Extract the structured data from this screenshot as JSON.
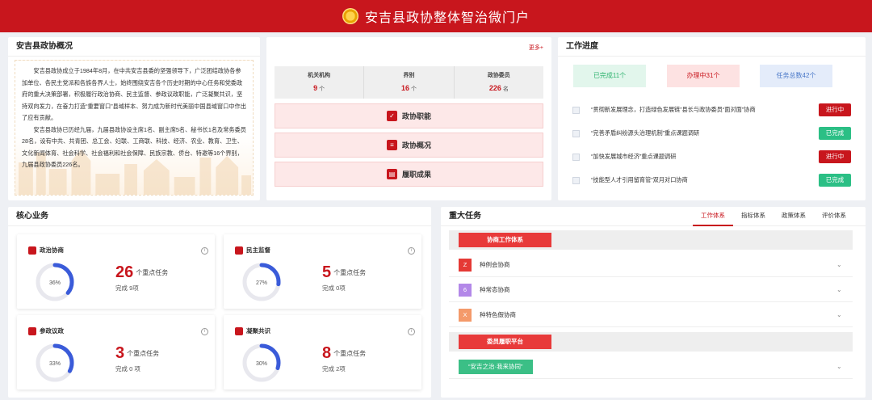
{
  "header": {
    "title": "安吉县政协整体智治微门户"
  },
  "intro": {
    "title": "安吉县政协概况",
    "paragraphs": [
      "安吉县政协成立于1984年8月，在中共安吉县委的坚强领导下，广泛团结政协各参加单位、各民主党派和各族各界人士，始终围绕安吉各个历史时期的中心任务和党委政府的重大决策部署，积极履行政治协商、民主监督、参政议政职能，广泛凝聚共识，坚持双向发力，在奋力打造“重要窗口”县域样本、努力成为新时代美丽中国县域窗口中作出了应有贡献。",
      "安吉县政协已历经九届，九届县政协设主席1名、副主席5名、秘书长1名及常务委员28名，设有中共、共青团、总工会、妇联、工商联、科技、经济、农业、教育、卫生、文化新闻体育、社会科学、社会福利和社会保障、民族宗教、侨台、特邀等16个界别，九届县政协委员226名。"
    ]
  },
  "overview": {
    "more": "更多+",
    "stats": [
      {
        "label": "机关机构",
        "value": "9",
        "unit": "个"
      },
      {
        "label": "界别",
        "value": "16",
        "unit": "个"
      },
      {
        "label": "政协委员",
        "value": "226",
        "unit": "名"
      }
    ],
    "buttons": [
      "政协职能",
      "政协概况",
      "履职成果"
    ]
  },
  "progress": {
    "title": "工作进度",
    "chips": [
      {
        "label": "已完成11个",
        "bg": "#e2f6ec",
        "color": "#2fb36f"
      },
      {
        "label": "办理中31个",
        "bg": "#fde2e2",
        "color": "#c8161d"
      },
      {
        "label": "任务总数42个",
        "bg": "#e4ecfa",
        "color": "#4a78c8"
      }
    ],
    "tasks": [
      {
        "text": "“贯彻新发展理念，打造绿色发展链”县长与政协委员“面对面”协商",
        "status": "进行中",
        "color": "#c8161d"
      },
      {
        "text": "“完善矛盾纠纷源头治理机制”重点课题调研",
        "status": "已完成",
        "color": "#2bbf85"
      },
      {
        "text": "“加快发展城市经济”重点课题调研",
        "status": "进行中",
        "color": "#c8161d"
      },
      {
        "text": "“技能型人才引用留育管”双月对口协商",
        "status": "已完成",
        "color": "#2bbf85"
      }
    ]
  },
  "core": {
    "title": "核心业务",
    "unit_text": "个重点任务",
    "cards": [
      {
        "name": "政治协商",
        "percent": "36%",
        "percent_value": 36,
        "count": "26",
        "done": "完成 9项"
      },
      {
        "name": "民主监督",
        "percent": "27%",
        "percent_value": 27,
        "count": "5",
        "done": "完成 0项"
      },
      {
        "name": "参政议政",
        "percent": "33%",
        "percent_value": 33,
        "count": "3",
        "done": "完成 0 项"
      },
      {
        "name": "凝聚共识",
        "percent": "30%",
        "percent_value": 30,
        "count": "8",
        "done": "完成 2项"
      }
    ]
  },
  "major": {
    "title": "重大任务",
    "tabs": [
      "工作体系",
      "指标体系",
      "政策体系",
      "评价体系"
    ],
    "group1": "协商工作体系",
    "rows": [
      {
        "badge": "Z",
        "label": "种例会协商",
        "color": "#e53935"
      },
      {
        "badge": "6",
        "label": "种常态协商",
        "color": "#b388e8"
      },
      {
        "badge": "X",
        "label": "种特色假协商",
        "color": "#f49a6a"
      }
    ],
    "group2": "委员履职平台",
    "platform": "“安吉之治·我来协同”"
  }
}
